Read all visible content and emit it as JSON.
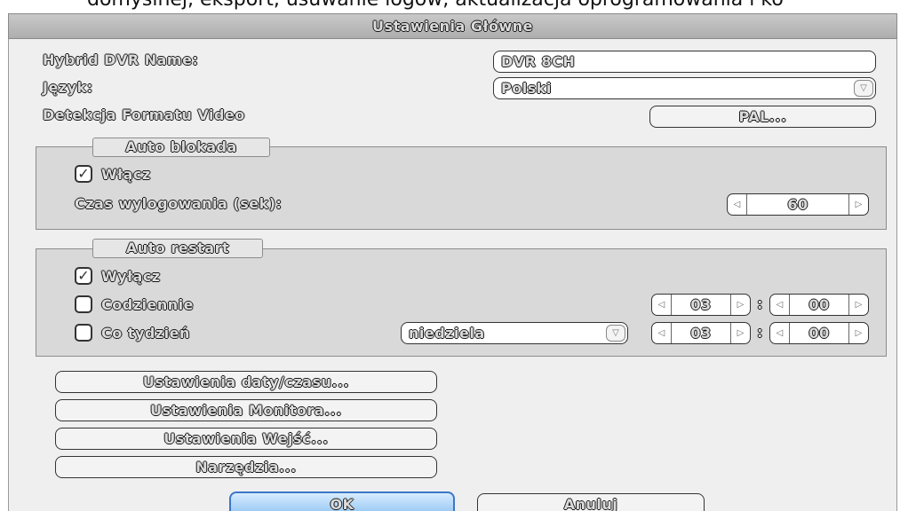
{
  "caption": "domyślnej, eksport, usuwanie logów, aktualizacja oprogramowania i ko",
  "dialog": {
    "title": "Ustawienia Główne"
  },
  "general": {
    "name_label": "Hybrid DVR Name:",
    "name_value": "DVR 8CH",
    "language_label": "Język:",
    "language_value": "Polski",
    "video_format_label": "Detekcja Formatu Video",
    "video_format_button": "PAL..."
  },
  "auto_lock": {
    "legend": "Auto blokada",
    "enable_label": "Włącz",
    "enable_checked": true,
    "logout_label": "Czas wylogowania (sek):",
    "logout_value": "60"
  },
  "auto_restart": {
    "legend": "Auto restart",
    "disable_label": "Wyłącz",
    "disable_checked": true,
    "daily_label": "Codziennie",
    "daily_checked": false,
    "daily_hour": "03",
    "daily_minute": "00",
    "weekly_label": "Co tydzień",
    "weekly_checked": false,
    "weekly_day": "niedziela",
    "weekly_hour": "03",
    "weekly_minute": "00",
    "time_separator": ":"
  },
  "buttons": {
    "datetime": "Ustawienia daty/czasu...",
    "monitor": "Ustawienia Monitora...",
    "inputs": "Ustawienia Wejść...",
    "tools": "Narzędzia...",
    "ok": "OK",
    "cancel": "Anuluj"
  },
  "icons": {
    "check": "✓",
    "arrow_left": "◁",
    "arrow_right": "▷",
    "dropdown": "▽"
  }
}
